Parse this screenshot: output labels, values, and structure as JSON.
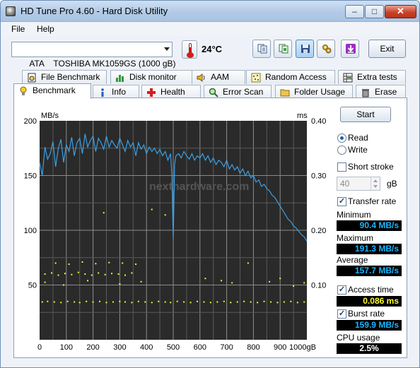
{
  "window": {
    "title": "HD Tune Pro 4.60 - Hard Disk Utility"
  },
  "menu": {
    "file": "File",
    "help": "Help"
  },
  "toolbar": {
    "drive": "ATA    TOSHIBA MK1059GS (1000 gB)",
    "temperature": "24°C",
    "exit_label": "Exit"
  },
  "tabs_row1": [
    "File Benchmark",
    "Disk monitor",
    "AAM",
    "Random Access",
    "Extra tests"
  ],
  "tabs_row2": [
    "Benchmark",
    "Info",
    "Health",
    "Error Scan",
    "Folder Usage",
    "Erase"
  ],
  "controls": {
    "start_label": "Start",
    "read_label": "Read",
    "write_label": "Write",
    "short_stroke_label": "Short stroke",
    "short_stroke_value": "40",
    "short_stroke_unit": "gB",
    "transfer_rate_label": "Transfer rate",
    "access_time_label": "Access time",
    "burst_rate_label": "Burst rate",
    "cpu_usage_label": "CPU usage"
  },
  "stats": {
    "minimum_label": "Minimum",
    "minimum_value": "90.4 MB/s",
    "maximum_label": "Maximum",
    "maximum_value": "191.3 MB/s",
    "average_label": "Average",
    "average_value": "157.7 MB/s",
    "access_time_value": "0.086 ms",
    "burst_rate_value": "159.9 MB/s",
    "cpu_usage_value": "2.5%"
  },
  "chart_data": {
    "type": "line",
    "left_unit": "MB/s",
    "right_unit": "ms",
    "watermark": "nexthardware.com",
    "x_ticks": [
      "0",
      "100",
      "200",
      "300",
      "400",
      "500",
      "600",
      "700",
      "800",
      "900",
      "1000gB"
    ],
    "y_left_ticks": [
      "200",
      "150",
      "100",
      "50"
    ],
    "y_right_ticks": [
      "0.40",
      "0.30",
      "0.20",
      "0.10"
    ],
    "xlim": [
      0,
      1000
    ],
    "ylim_left": [
      0,
      200
    ],
    "ylim_right": [
      0,
      0.4
    ],
    "grid": true,
    "transfer_rate": {
      "x": [
        0,
        10,
        20,
        30,
        40,
        50,
        60,
        70,
        80,
        90,
        100,
        110,
        120,
        130,
        140,
        150,
        160,
        170,
        180,
        190,
        200,
        210,
        220,
        230,
        240,
        250,
        260,
        270,
        280,
        290,
        300,
        310,
        320,
        330,
        340,
        350,
        360,
        370,
        380,
        390,
        400,
        410,
        420,
        430,
        440,
        450,
        460,
        470,
        480,
        490,
        495,
        500,
        505,
        510,
        520,
        530,
        540,
        550,
        560,
        570,
        580,
        590,
        600,
        610,
        620,
        630,
        640,
        650,
        660,
        670,
        680,
        690,
        700,
        710,
        720,
        730,
        740,
        750,
        760,
        770,
        780,
        790,
        800,
        810,
        820,
        830,
        840,
        850,
        860,
        870,
        880,
        890,
        900,
        910,
        920,
        930,
        940,
        950,
        960,
        970,
        980,
        990,
        1000
      ],
      "y": [
        162,
        150,
        176,
        165,
        170,
        181,
        158,
        175,
        183,
        162,
        178,
        172,
        185,
        168,
        180,
        184,
        170,
        188,
        176,
        182,
        186,
        172,
        184,
        180,
        174,
        186,
        176,
        182,
        178,
        175,
        184,
        178,
        172,
        182,
        176,
        180,
        168,
        180,
        174,
        178,
        170,
        176,
        172,
        175,
        170,
        174,
        168,
        172,
        164,
        170,
        150,
        92,
        160,
        168,
        170,
        166,
        172,
        168,
        165,
        170,
        164,
        168,
        166,
        170,
        164,
        168,
        162,
        166,
        160,
        164,
        162,
        158,
        164,
        156,
        160,
        155,
        158,
        152,
        156,
        150,
        154,
        148,
        150,
        144,
        146,
        140,
        142,
        138,
        136,
        132,
        130,
        126,
        122,
        118,
        114,
        110,
        108,
        104,
        102,
        99,
        96,
        94,
        90
      ]
    },
    "access_time_ms": {
      "x": [
        10,
        30,
        55,
        80,
        105,
        130,
        150,
        175,
        200,
        225,
        250,
        275,
        300,
        320,
        345,
        370,
        395,
        420,
        445,
        470,
        490,
        515,
        540,
        565,
        590,
        615,
        640,
        665,
        690,
        715,
        740,
        765,
        790,
        815,
        840,
        865,
        890,
        915,
        940,
        965,
        990,
        20,
        45,
        70,
        95,
        120,
        145,
        170,
        195,
        220,
        245,
        270,
        295,
        320,
        345,
        60,
        110,
        160,
        210,
        260,
        310,
        360,
        20,
        90,
        180,
        300,
        380,
        240,
        420,
        470,
        620,
        680,
        720,
        780,
        860,
        900,
        950,
        990
      ],
      "y": [
        0.069,
        0.07,
        0.069,
        0.068,
        0.07,
        0.069,
        0.068,
        0.07,
        0.069,
        0.07,
        0.068,
        0.069,
        0.07,
        0.069,
        0.068,
        0.07,
        0.069,
        0.068,
        0.07,
        0.069,
        0.068,
        0.07,
        0.069,
        0.068,
        0.07,
        0.069,
        0.068,
        0.069,
        0.07,
        0.068,
        0.069,
        0.07,
        0.069,
        0.068,
        0.07,
        0.069,
        0.068,
        0.069,
        0.07,
        0.068,
        0.069,
        0.12,
        0.122,
        0.118,
        0.121,
        0.119,
        0.123,
        0.12,
        0.118,
        0.122,
        0.119,
        0.121,
        0.12,
        0.118,
        0.122,
        0.14,
        0.138,
        0.142,
        0.139,
        0.141,
        0.14,
        0.138,
        0.105,
        0.1,
        0.108,
        0.102,
        0.106,
        0.232,
        0.238,
        0.228,
        0.112,
        0.108,
        0.104,
        0.14,
        0.106,
        0.112,
        0.098,
        0.104
      ]
    }
  }
}
